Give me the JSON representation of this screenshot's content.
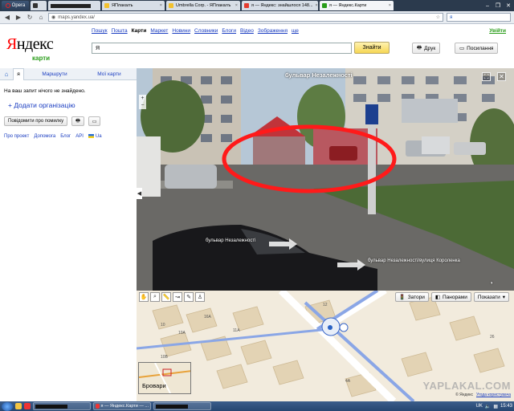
{
  "browser": {
    "opera_label": "Opera",
    "tabs": [
      {
        "title": "",
        "redacted": true,
        "color": "#333333"
      },
      {
        "title": "ЯПлакалъ",
        "color": "#f2c12e"
      },
      {
        "title": "Umbrella Corp. - ЯПлакалъ",
        "color": "#f2c12e"
      },
      {
        "title": "я — Яндекс: знайшлося 148...",
        "color": "#e33b2f"
      },
      {
        "title": "я — Яндекс.Карти",
        "color": "#2a9d1a",
        "active": true
      }
    ],
    "url": "maps.yandex.ua/",
    "search_value": "я"
  },
  "yandex": {
    "logo": "Яндекс",
    "logo_sub": "карти",
    "services": [
      "Пошук",
      "Пошта",
      "Карти",
      "Маркет",
      "Новини",
      "Словники",
      "Блоги",
      "Відео",
      "Зображення",
      "ще"
    ],
    "current_service": "Карти",
    "enter": "Увійти",
    "search_value": "Я",
    "find_button": "Знайти",
    "print_button": "Друк",
    "link_button": "Посилання"
  },
  "left_panel": {
    "tabs": {
      "search": "я",
      "routes": "Маршрути",
      "mine": "Мої карти"
    },
    "no_result": "На ваш запит нічого не знайдено.",
    "add_org": "+ Додати організацію",
    "report_error": "Повідомити про помилку",
    "links": [
      "Про проект",
      "Допомога",
      "Блог",
      "API",
      "Ua"
    ]
  },
  "panorama": {
    "title": "бульвар Незалежності",
    "street_label_1": "бульвар Незалежності",
    "street_label_2": "бульвар Незалежності/вулиця Короленка",
    "highlight_color": "#ff1a1a"
  },
  "map": {
    "layers": {
      "traffic": "Затори",
      "panoramas": "Панорами",
      "show": "Показати"
    },
    "minimap_label": "Бровари",
    "watermark": "YAPLAKAL.COM",
    "copyright": "© Яндекс",
    "terms": "Угода користувача",
    "house_numbers": [
      "10",
      "16А",
      "10А",
      "11А",
      "12",
      "4А",
      "10В",
      "26"
    ]
  },
  "taskbar": {
    "tasks": [
      {
        "title": "",
        "redacted": true
      },
      {
        "title": "я — Яндекс.Карти — ...",
        "redacted": false
      },
      {
        "title": "",
        "redacted": true
      }
    ],
    "tray_lang": "UK",
    "clock": "15:43"
  }
}
